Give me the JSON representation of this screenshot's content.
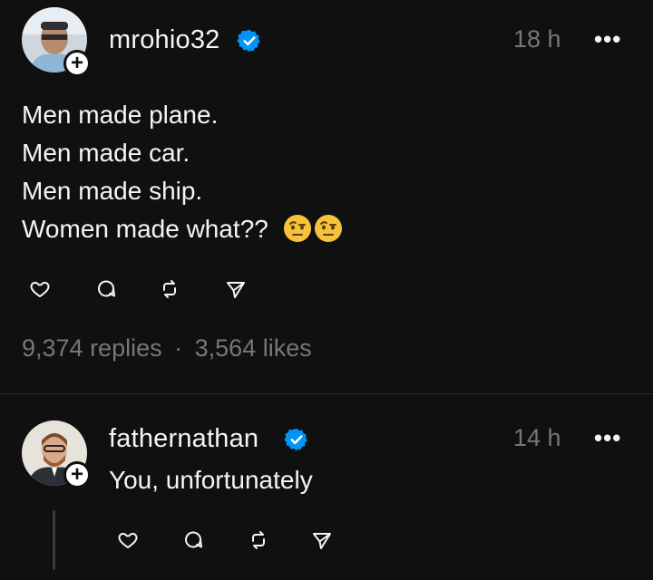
{
  "post": {
    "username": "mrohio32",
    "time": "18 h",
    "more": "•••",
    "lines": [
      "Men made plane.",
      "Men made car.",
      "Men made ship.",
      "Women made what??"
    ],
    "emoji": "raised-eyebrow-face-emoji",
    "replies": "9,374 replies",
    "separator": "·",
    "likes": "3,564 likes"
  },
  "reply": {
    "username": "fathernathan",
    "time": "14 h",
    "more": "•••",
    "text": "You, unfortunately"
  },
  "follow_symbol": "+",
  "colors": {
    "background": "#101010",
    "verified": "#0095f6",
    "muted": "#777777"
  }
}
